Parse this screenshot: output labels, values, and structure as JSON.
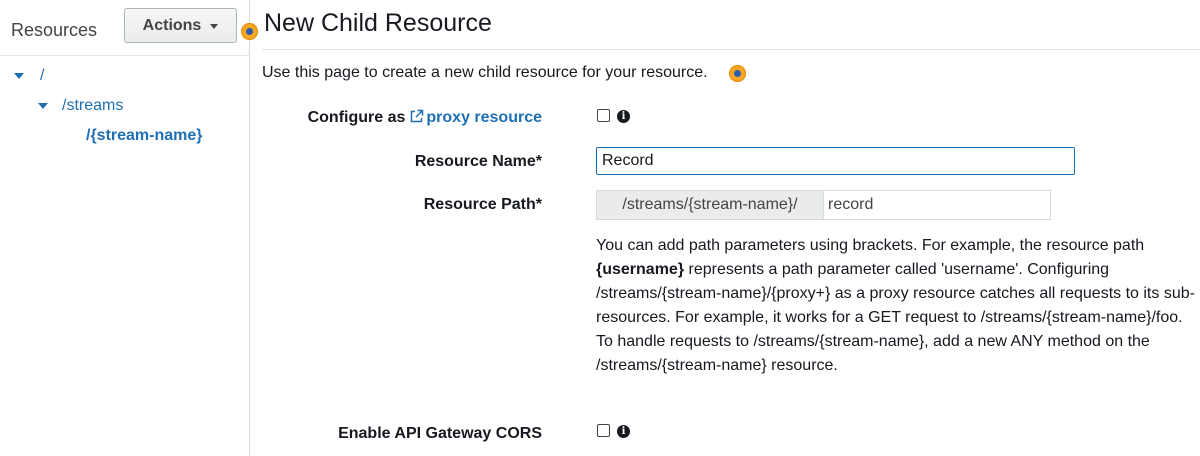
{
  "sidebar": {
    "title": "Resources",
    "actions_label": "Actions",
    "tree": [
      {
        "label": "/"
      },
      {
        "label": "/streams"
      },
      {
        "label": "/{stream-name}"
      }
    ]
  },
  "main": {
    "title": "New Child Resource",
    "intro": "Use this page to create a new child resource for your resource.",
    "configure": {
      "label_prefix": "Configure as",
      "link_text": "proxy resource",
      "checked": false
    },
    "resource_name": {
      "label": "Resource Name*",
      "value": "Record"
    },
    "resource_path": {
      "label": "Resource Path*",
      "prefix": "/streams/{stream-name}/",
      "value": "record"
    },
    "help": {
      "part1": "You can add path parameters using brackets. For example, the resource path ",
      "bold": "{username}",
      "part2": " represents a path parameter called 'username'. Configuring /streams/{stream-name}/{proxy+} as a proxy resource catches all requests to its sub-resources. For example, it works for a GET request to /streams/{stream-name}/foo. To handle requests to /streams/{stream-name}, add a new ANY method on the /streams/{stream-name} resource."
    },
    "cors": {
      "label": "Enable API Gateway CORS",
      "checked": false
    },
    "info_glyph": "i"
  },
  "colors": {
    "link": "#1f6fb5",
    "marker": "#f5a623",
    "input_focus_border": "#1f6fb5"
  },
  "icons": {
    "actions_dropdown": "caret-down-icon",
    "tree_expand": "caret-down-icon",
    "external_link": "external-link-icon",
    "info": "info-icon",
    "marker": "hotspot-marker-icon"
  }
}
